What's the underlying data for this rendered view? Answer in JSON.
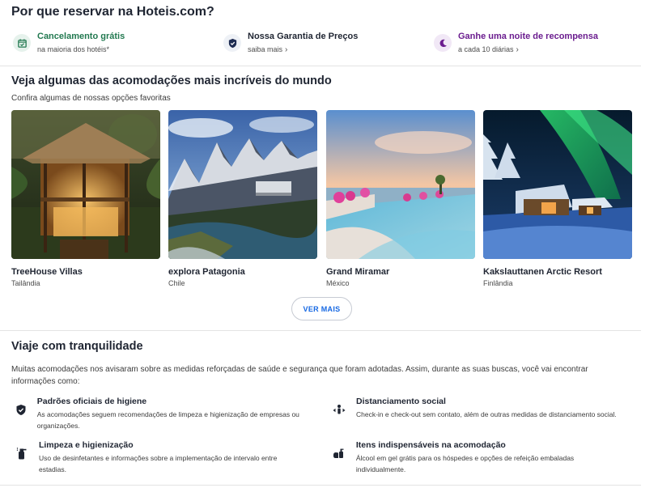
{
  "why": {
    "title": "Por que reservar na Hoteis.com?",
    "items": [
      {
        "label": "Cancelamento grátis",
        "sub": "na maioria dos hotéis*",
        "color": "#227950",
        "icon": "calendar-check-icon"
      },
      {
        "label": "Nossa Garantia de Preços",
        "sub": "saiba mais",
        "color": "#1f2532",
        "icon": "shield-check-icon"
      },
      {
        "label": "Ganhe uma noite de recompensa",
        "sub": "a cada 10 diárias",
        "color": "#6b1d8f",
        "icon": "moon-icon"
      }
    ]
  },
  "featured": {
    "title": "Veja algumas das acomodações mais incríveis do mundo",
    "subtitle": "Confira algumas de nossas opções favoritas",
    "cards": [
      {
        "name": "TreeHouse Villas",
        "country": "Tailândia"
      },
      {
        "name": "explora Patagonia",
        "country": "Chile"
      },
      {
        "name": "Grand Miramar",
        "country": "México"
      },
      {
        "name": "Kakslauttanen Arctic Resort",
        "country": "Finlândia"
      }
    ],
    "more_label": "VER MAIS"
  },
  "travel": {
    "title": "Viaje com tranquilidade",
    "intro": "Muitas acomodações nos avisaram sobre as medidas reforçadas de saúde e segurança que foram adotadas. Assim, durante as suas buscas, você vai encontrar informações como:",
    "items": [
      {
        "title": "Padrões oficiais de higiene",
        "desc": "As acomodações seguem recomendações de limpeza e higienização de empresas ou organizações.",
        "icon": "shield-check-icon"
      },
      {
        "title": "Distanciamento social",
        "desc": "Check-in e check-out sem contato, além de outras medidas de distanciamento social.",
        "icon": "social-distance-icon"
      },
      {
        "title": "Limpeza e higienização",
        "desc": "Uso de desinfetantes e informações sobre a implementação de intervalo entre estadias.",
        "icon": "spray-bottle-icon"
      },
      {
        "title": "Itens indispensáveis na acomodação",
        "desc": "Álcool em gel grátis para os hóspedes e opções de refeição embaladas individualmente.",
        "icon": "hand-sanitizer-icon"
      }
    ]
  }
}
